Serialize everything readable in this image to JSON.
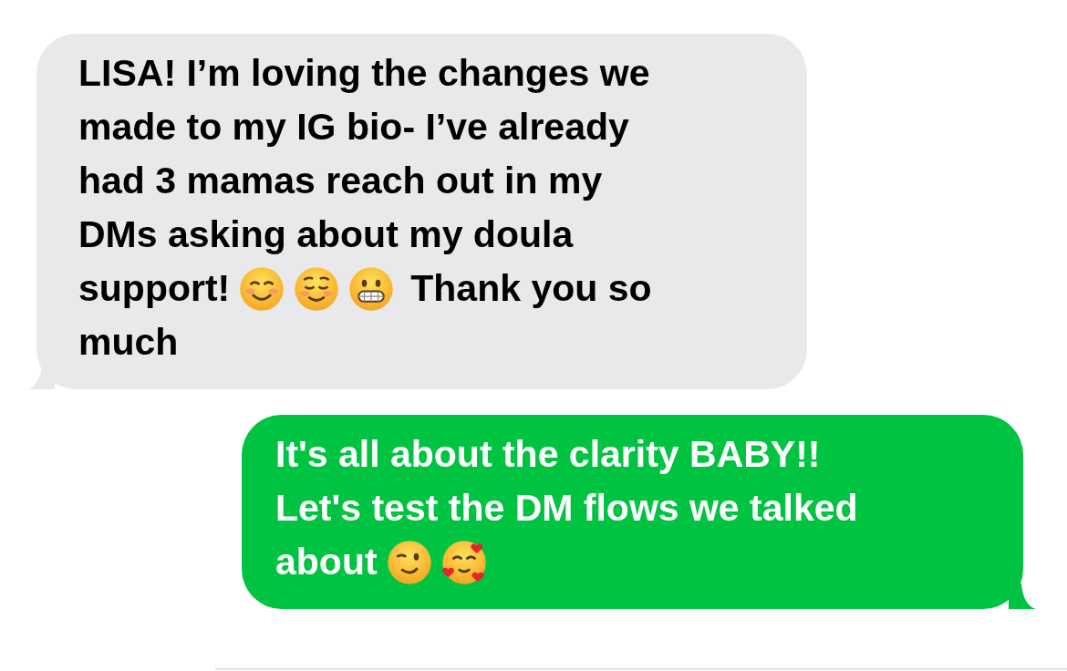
{
  "messages": [
    {
      "kind": "received",
      "lines": [
        [
          {
            "kind": "text",
            "text": "LISA! I’m loving the changes we"
          }
        ],
        [
          {
            "kind": "text",
            "text": "made to my IG bio- I’ve already"
          }
        ],
        [
          {
            "kind": "text",
            "text": "had 3 mamas reach out in my"
          }
        ],
        [
          {
            "kind": "text",
            "text": "DMs asking about my doula"
          }
        ],
        [
          {
            "kind": "text",
            "text": "support!"
          },
          {
            "kind": "smile"
          },
          {
            "kind": "blush"
          },
          {
            "kind": "grimace"
          },
          {
            "kind": "text",
            "text": "Thank you so"
          }
        ],
        [
          {
            "kind": "text",
            "text": "much"
          }
        ]
      ]
    },
    {
      "kind": "sent",
      "lines": [
        [
          {
            "kind": "text",
            "text": "It's all about the clarity BABY!!"
          }
        ],
        [
          {
            "kind": "text",
            "text": "Let's test the DM flows we talked"
          }
        ],
        [
          {
            "kind": "text",
            "text": "about"
          },
          {
            "kind": "wink"
          },
          {
            "kind": "hearts"
          }
        ]
      ]
    }
  ]
}
